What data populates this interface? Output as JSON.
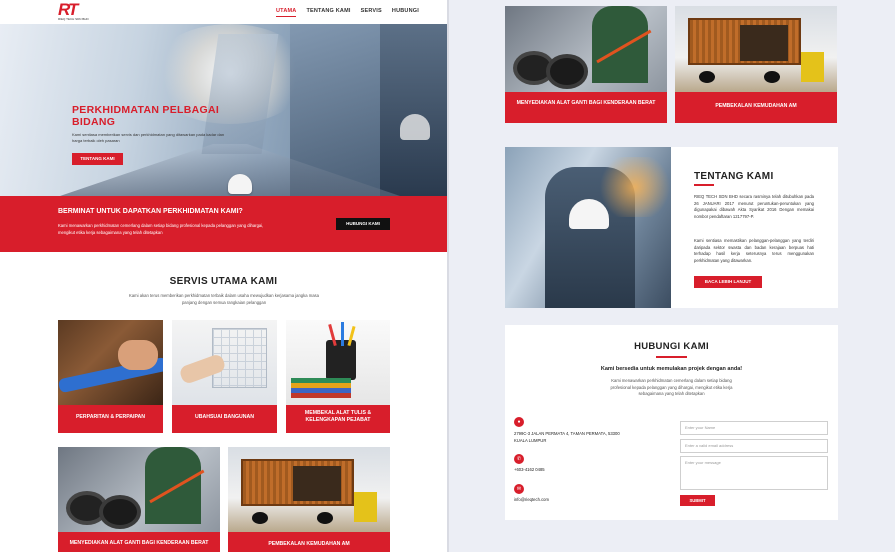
{
  "brand": {
    "logo_mark": "RT",
    "logo_sub": "RIEQ TECH SDN BHD",
    "accent": "#d81e2b"
  },
  "nav": {
    "items": [
      "UTAMA",
      "TENTANG KAMI",
      "SERVIS",
      "HUBUNGI"
    ],
    "active": "UTAMA"
  },
  "hero": {
    "title": "PERKHIDMATAN PELBAGAI BIDANG",
    "desc": "Kami sentiasa memberikan servis dan perkhidmatan yang ditawarkan pada kadar dan harga terbaik oleh pasaran",
    "button": "TENTANG KAMI"
  },
  "cta": {
    "title": "BERMINAT UNTUK DAPATKAN PERKHIDMATAN KAMI?",
    "desc": "Kami menawarkan perkhidmatan cemerlang dalam setiap bidang profesional kepada pelanggan yang dihargai, mengikut etika kerja sebagaimana yang telah ditetapkan",
    "button": "HUBUNGI KAMI"
  },
  "services": {
    "title": "SERVIS UTAMA KAMI",
    "desc": "Kami akan terus memberikan perkhidmatan terbaik dalam usaha mewujudkan kerjasama jangka masa panjang dengan semua rangkaian pelanggan",
    "cards": [
      {
        "label": "PERPARITAN & PERPAIPAN",
        "icon": "pipe-work-photo"
      },
      {
        "label": "UBAHSUAI BANGUNAN",
        "icon": "building-drawing-photo"
      },
      {
        "label": "MEMBEKAL ALAT TULIS & KELENGKAPAN PEJABAT",
        "icon": "stationery-photo"
      },
      {
        "label": "MENYEDIAKAN ALAT GANTI BAGI KENDERAAN BERAT",
        "icon": "truck-parts-photo"
      },
      {
        "label": "PEMBEKALAN KEMUDAHAN AM",
        "icon": "cargo-truck-photo"
      }
    ]
  },
  "about": {
    "title": "TENTANG KAMI",
    "p1": "RIEQ TECH SDN BHD secara rasminya telah ditubuhkan pada 26 JANUARI 2017 menurut peruntukan-peruntukan yang digunapakai dibawah Akta Syarikat 2016 Dengan memakai nombor pendaftaran 1217797-P.",
    "p2": "Kami sentiasa memastikan pelanggan-pelanggan yang terdiri daripada sektor swasta dan badan kerajaan berpuas hati terhadap hasil kerja seterusnya terus menggunakan perkhidmatan yang ditawarkan.",
    "button": "BACA LEBIH LANJUT"
  },
  "contact": {
    "title": "HUBUNGI KAMI",
    "subtitle": "Kami bersedia untuk memulakan projek dengan anda!",
    "desc": "Kami menawarkan perkhidmatan cemerlang dalam setiap bidang profesional kepada pelanggan yang dihargai, mengikut etika kerja sebagaimana yang telah ditetapkan",
    "address_line1": "2799C-3 JALAN PERMATA 4, TAMAN PERMATA, 53300",
    "address_line2": "KUALA LUMPUR",
    "phone": "+603-4162 0485",
    "email": "info@rieqtech.com",
    "name_placeholder": "Enter your Name",
    "email_placeholder": "Enter a valid email address",
    "message_placeholder": "Enter your message",
    "submit": "SUBMIT"
  }
}
